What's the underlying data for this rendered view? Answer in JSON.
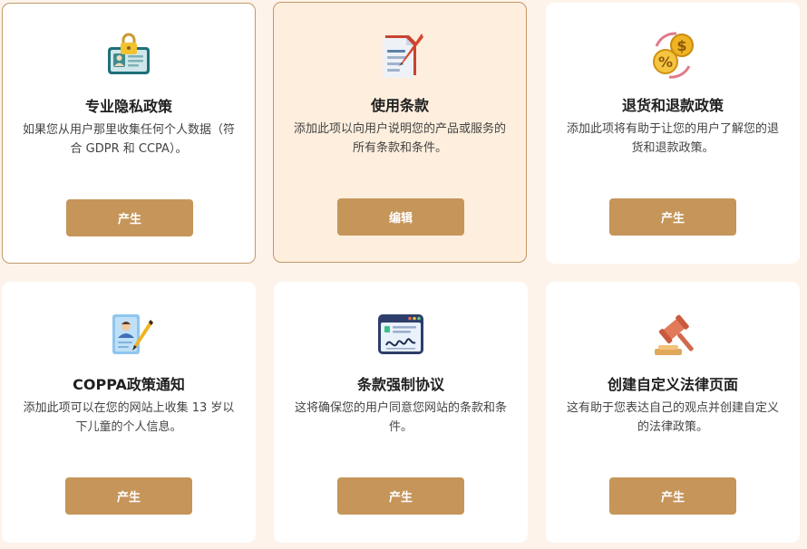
{
  "colors": {
    "page_background": "#fdf3ea",
    "card_background": "#ffffff",
    "selected_card_background": "#fdeedd",
    "card_border": "#c09a6b",
    "button": "#c5955a",
    "button_text": "#ffffff"
  },
  "cards": [
    {
      "icon": "id-card-lock-icon",
      "title": "专业隐私政策",
      "description": "如果您从用户那里收集任何个人数据（符合 GDPR 和 CCPA）。",
      "button": "产生"
    },
    {
      "icon": "document-quill-icon",
      "title": "使用条款",
      "description": "添加此项以向用户说明您的产品或服务的所有条款和条件。",
      "button": "编辑"
    },
    {
      "icon": "refund-coins-icon",
      "title": "退货和退款政策",
      "description": "添加此项将有助于让您的用户了解您的退货和退款政策。",
      "button": "产生"
    },
    {
      "icon": "child-profile-pen-icon",
      "title": "COPPA政策通知",
      "description": "添加此项可以在您的网站上收集 13 岁以下儿童的个人信息。",
      "button": "产生"
    },
    {
      "icon": "signed-browser-window-icon",
      "title": "条款强制协议",
      "description": "这将确保您的用户同意您网站的条款和条件。",
      "button": "产生"
    },
    {
      "icon": "gavel-icon",
      "title": "创建自定义法律页面",
      "description": "这有助于您表达自己的观点并创建自定义的法律政策。",
      "button": "产生"
    }
  ]
}
